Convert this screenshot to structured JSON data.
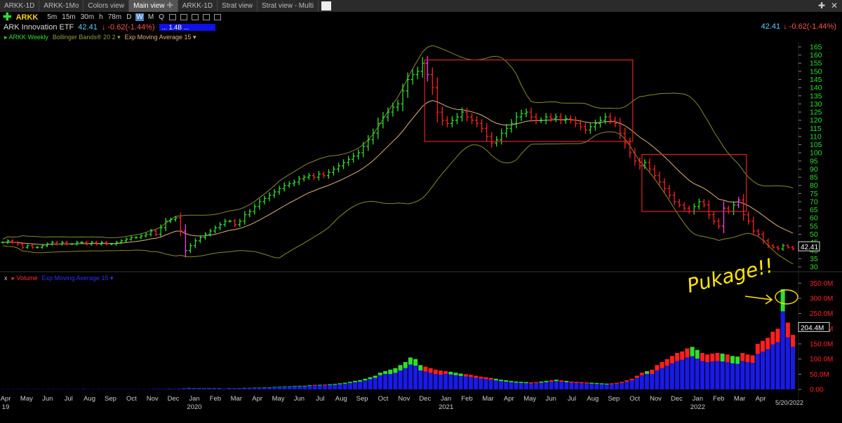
{
  "tabs": [
    {
      "label": "ARKK-1D",
      "active": false
    },
    {
      "label": "ARKK-1Mo",
      "active": false
    },
    {
      "label": "Colors view",
      "active": false
    },
    {
      "label": "Main view",
      "active": true
    },
    {
      "label": "ARKK-1D",
      "active": false
    },
    {
      "label": "Strat view",
      "active": false
    },
    {
      "label": "Strat view - Multi",
      "active": false
    }
  ],
  "toolbar": {
    "symbol": "ARKK",
    "timeframes": [
      "5m",
      "15m",
      "30m",
      "h",
      "78m",
      "D",
      "W",
      "M",
      "Q"
    ],
    "active_timeframe": "W"
  },
  "quote": {
    "name": "ARK Innovation ETF",
    "price": "42.41",
    "change": "-0.62(-1.44%)",
    "volume": "... 1.4B ..."
  },
  "studies": {
    "series": "ARKK Weekly",
    "bb": "Bollinger Bands® 20 2",
    "ema": "Exp Moving Average 15"
  },
  "volume_legend": {
    "close": "x",
    "vol": "Volume",
    "ema": "Exp Moving Average 15"
  },
  "annotation": "Pukage!!",
  "price_label": "42.41",
  "volume_label": "204.4M",
  "last_date": "5/20/2022",
  "colors": {
    "up": "#2ee02e",
    "down": "#ff2020",
    "box": "#e02020",
    "bb": "#8a8a2a",
    "ema": "#e3b27a",
    "vol_blue": "#1a1ae6",
    "magenta": "#ff3cf0",
    "annotation": "#ffe600"
  },
  "chart_data": [
    {
      "type": "ohlc",
      "series": "ARKK Weekly",
      "y_ticks": [
        30,
        35,
        40,
        45,
        50,
        55,
        60,
        65,
        70,
        75,
        80,
        85,
        90,
        95,
        100,
        105,
        110,
        115,
        120,
        125,
        130,
        135,
        140,
        145,
        150,
        155,
        160,
        165
      ],
      "ylim": [
        27,
        168
      ],
      "x_tick_labels": [
        {
          "label": "Apr",
          "sub": "19"
        },
        {
          "label": "May"
        },
        {
          "label": "Jun"
        },
        {
          "label": "Jul"
        },
        {
          "label": "Aug"
        },
        {
          "label": "Sep"
        },
        {
          "label": "Oct"
        },
        {
          "label": "Nov"
        },
        {
          "label": "Dec"
        },
        {
          "label": "Jan",
          "sub": "2020"
        },
        {
          "label": "Feb"
        },
        {
          "label": "Mar"
        },
        {
          "label": "Apr"
        },
        {
          "label": "May"
        },
        {
          "label": "Jun"
        },
        {
          "label": "Jul"
        },
        {
          "label": "Aug"
        },
        {
          "label": "Sep"
        },
        {
          "label": "Oct"
        },
        {
          "label": "Nov"
        },
        {
          "label": "Dec"
        },
        {
          "label": "Jan",
          "sub": "2021"
        },
        {
          "label": "Feb"
        },
        {
          "label": "Mar"
        },
        {
          "label": "Apr"
        },
        {
          "label": "May"
        },
        {
          "label": "Jun"
        },
        {
          "label": "Jul"
        },
        {
          "label": "Aug"
        },
        {
          "label": "Sep"
        },
        {
          "label": "Oct"
        },
        {
          "label": "Nov"
        },
        {
          "label": "Dec"
        },
        {
          "label": "Jan",
          "sub": "2022"
        },
        {
          "label": "Feb"
        },
        {
          "label": "Mar"
        },
        {
          "label": "Apr"
        }
      ],
      "close_series_approx": [
        45,
        46,
        45,
        44,
        42,
        43,
        42,
        42,
        43,
        44,
        45,
        44,
        45,
        44,
        44,
        45,
        45,
        44,
        45,
        44,
        45,
        44,
        44,
        45,
        46,
        47,
        48,
        48,
        49,
        50,
        52,
        50,
        54,
        58,
        59,
        60,
        52,
        40,
        43,
        46,
        48,
        50,
        52,
        54,
        56,
        58,
        58,
        56,
        58,
        62,
        64,
        67,
        70,
        72,
        74,
        76,
        78,
        80,
        81,
        82,
        84,
        85,
        86,
        85,
        87,
        86,
        88,
        90,
        92,
        94,
        96,
        98,
        100,
        104,
        108,
        112,
        118,
        122,
        125,
        128,
        130,
        138,
        145,
        148,
        150,
        155,
        148,
        140,
        125,
        120,
        118,
        120,
        122,
        125,
        122,
        120,
        118,
        115,
        110,
        106,
        108,
        112,
        115,
        118,
        122,
        124,
        125,
        122,
        120,
        120,
        122,
        121,
        122,
        120,
        121,
        120,
        118,
        116,
        114,
        116,
        118,
        120,
        122,
        120,
        118,
        112,
        106,
        100,
        95,
        92,
        94,
        90,
        86,
        82,
        78,
        74,
        70,
        68,
        66,
        64,
        67,
        70,
        68,
        62,
        58,
        55,
        66,
        64,
        68,
        71,
        62,
        58,
        52,
        50,
        46,
        43,
        42,
        41,
        43,
        42,
        41
      ],
      "boxes": [
        {
          "x_range": [
            "2021-02-15",
            "2021-12-13"
          ],
          "y_range": [
            107,
            157
          ]
        },
        {
          "x_range": [
            "2021-12-27",
            "2022-04-11"
          ],
          "y_range": [
            64,
            99
          ]
        }
      ]
    },
    {
      "type": "bar",
      "series": "Volume",
      "y_ticks": [
        "0.00",
        "50.0M",
        "100.0M",
        "150.0M",
        "200.0M",
        "250.0M",
        "300.0M",
        "350.0M"
      ],
      "ylim": [
        0,
        360
      ],
      "units": "M",
      "values_approx": [
        1,
        1,
        1,
        1,
        1,
        1,
        1,
        1,
        1,
        1,
        1,
        1,
        1,
        1,
        1,
        1,
        2,
        1,
        1,
        1,
        1,
        1,
        1,
        1,
        1,
        1,
        1,
        1,
        1,
        1,
        2,
        2,
        2,
        3,
        2,
        3,
        4,
        5,
        4,
        4,
        4,
        4,
        4,
        4,
        3,
        4,
        4,
        4,
        5,
        5,
        6,
        6,
        7,
        7,
        8,
        9,
        10,
        10,
        11,
        12,
        12,
        14,
        15,
        15,
        16,
        17,
        18,
        20,
        22,
        25,
        28,
        30,
        35,
        40,
        45,
        55,
        60,
        65,
        70,
        80,
        90,
        105,
        100,
        80,
        75,
        70,
        65,
        62,
        60,
        58,
        55,
        52,
        50,
        48,
        45,
        42,
        40,
        38,
        35,
        32,
        30,
        28,
        26,
        25,
        24,
        23,
        24,
        26,
        28,
        30,
        32,
        30,
        28,
        26,
        25,
        24,
        23,
        22,
        21,
        20,
        19,
        20,
        22,
        25,
        30,
        35,
        45,
        55,
        60,
        65,
        80,
        90,
        100,
        110,
        120,
        125,
        135,
        140,
        130,
        120,
        115,
        118,
        120,
        118,
        115,
        110,
        108,
        120,
        115,
        112,
        150,
        160,
        170,
        190,
        200,
        330,
        220,
        180
      ]
    }
  ]
}
